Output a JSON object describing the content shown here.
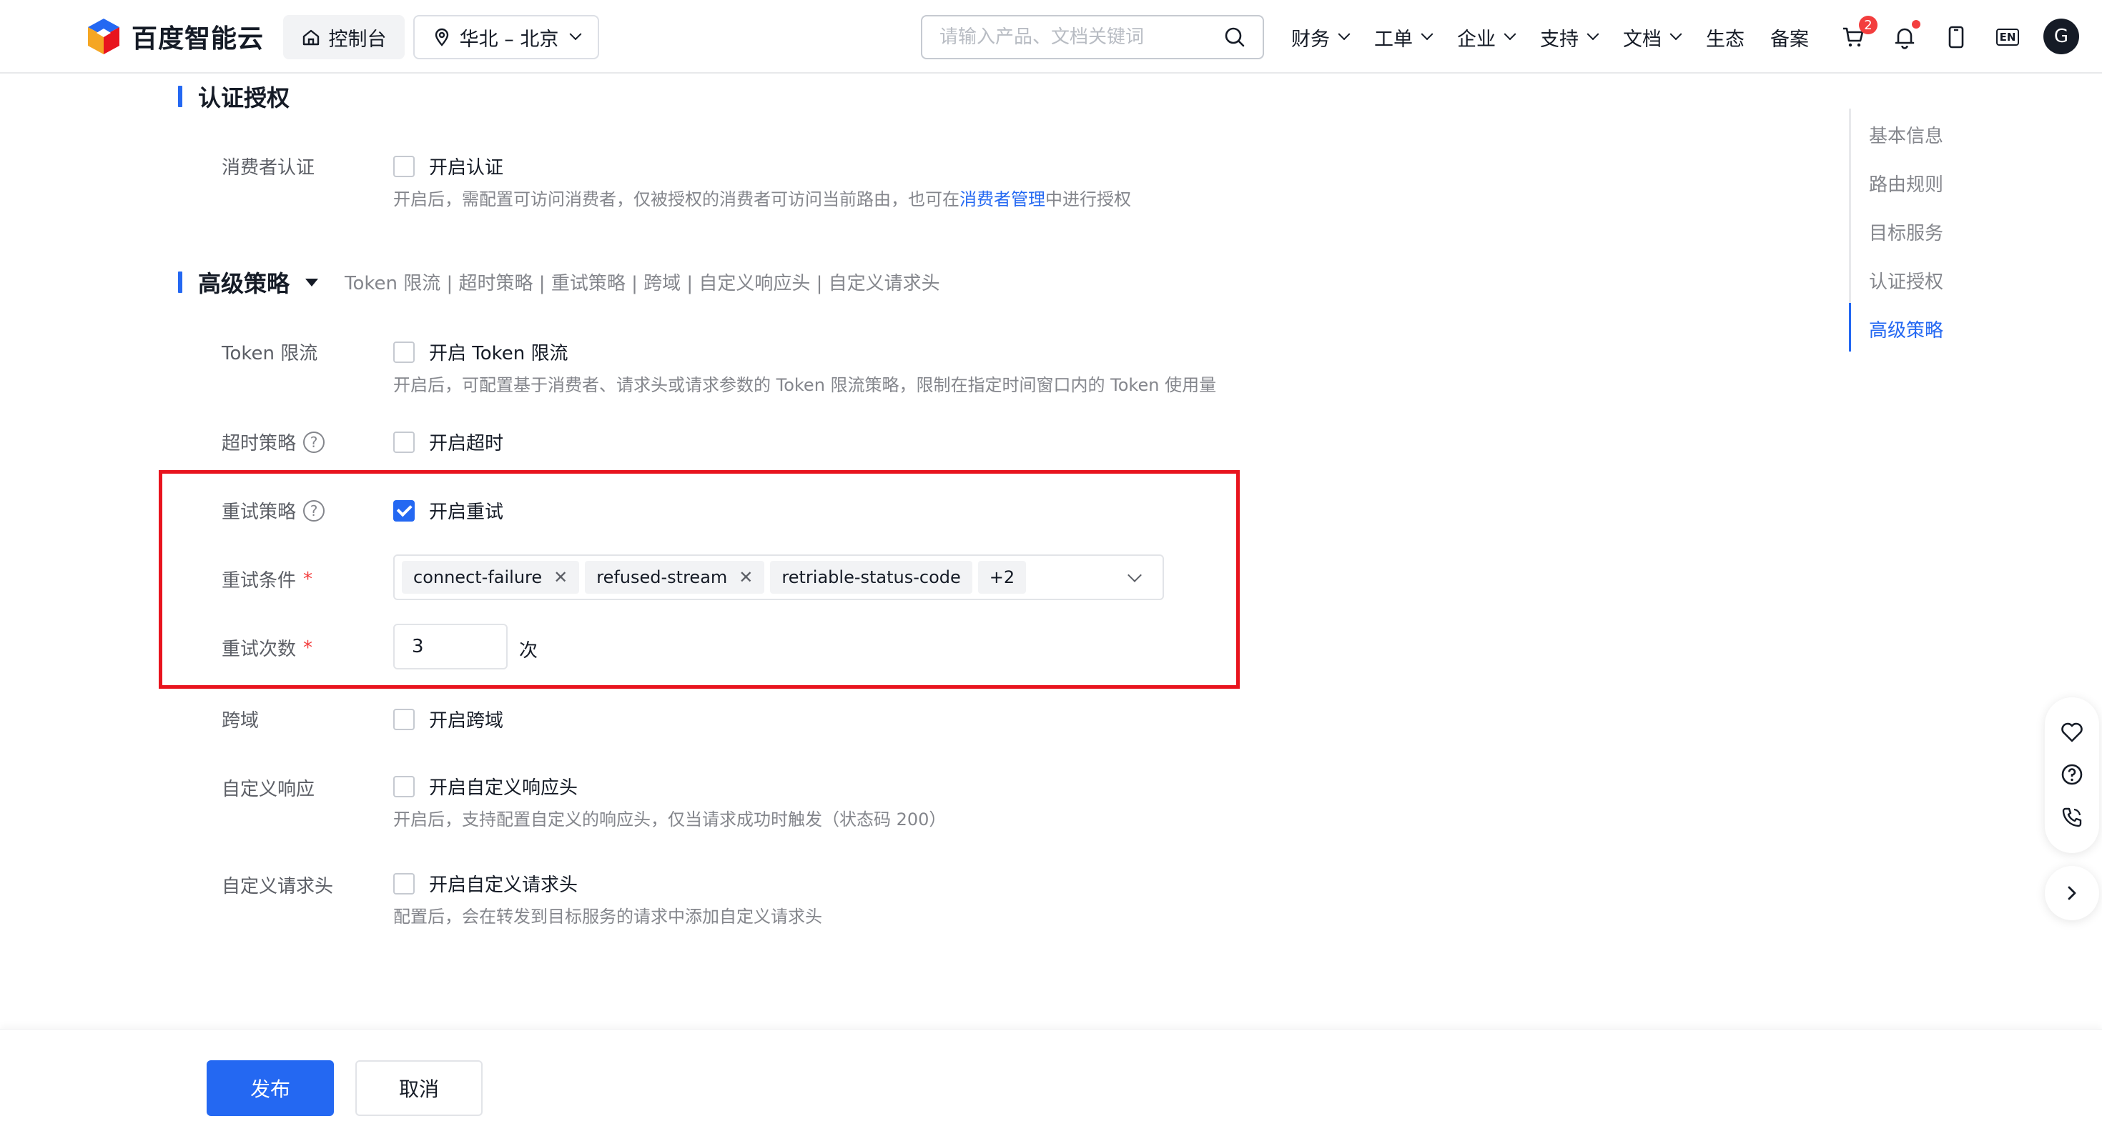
{
  "header": {
    "brand": "百度智能云",
    "console_label": "控制台",
    "region_label": "华北 – 北京",
    "search_placeholder": "请输入产品、文档关键词",
    "menus": [
      {
        "label": "财务",
        "dropdown": true
      },
      {
        "label": "工单",
        "dropdown": true
      },
      {
        "label": "企业",
        "dropdown": true
      },
      {
        "label": "支持",
        "dropdown": true
      },
      {
        "label": "文档",
        "dropdown": true
      },
      {
        "label": "生态",
        "dropdown": false
      },
      {
        "label": "备案",
        "dropdown": false
      }
    ],
    "cart_badge": "2",
    "lang_label": "EN",
    "avatar_initial": "G"
  },
  "auth": {
    "title": "认证授权",
    "consumer": {
      "label": "消费者认证",
      "checkbox_label": "开启认证",
      "checked": false,
      "desc_prefix": "开启后，需配置可访问消费者，仅被授权的消费者可访问当前路由，也可在",
      "desc_link": "消费者管理",
      "desc_suffix": "中进行授权"
    }
  },
  "advanced": {
    "title": "高级策略",
    "tags_summary": "Token 限流 | 超时策略 | 重试策略 | 跨域 | 自定义响应头 | 自定义请求头",
    "token_limit": {
      "label": "Token 限流",
      "checkbox_label": "开启 Token 限流",
      "checked": false,
      "desc": "开启后，可配置基于消费者、请求头或请求参数的 Token 限流策略，限制在指定时间窗口内的 Token 使用量"
    },
    "timeout": {
      "label": "超时策略",
      "checkbox_label": "开启超时",
      "checked": false
    },
    "retry": {
      "label": "重试策略",
      "checkbox_label": "开启重试",
      "checked": true,
      "conditions_label": "重试条件",
      "conditions_tags": [
        "connect-failure",
        "refused-stream",
        "retriable-status-code"
      ],
      "conditions_more": "+2",
      "count_label": "重试次数",
      "count_value": "3",
      "count_unit": "次"
    },
    "cors": {
      "label": "跨域",
      "checkbox_label": "开启跨域",
      "checked": false
    },
    "custom_response": {
      "label": "自定义响应",
      "checkbox_label": "开启自定义响应头",
      "checked": false,
      "desc": "开启后，支持配置自定义的响应头，仅当请求成功时触发（状态码 200）"
    },
    "custom_request": {
      "label": "自定义请求头",
      "checkbox_label": "开启自定义请求头",
      "checked": false,
      "desc": "配置后，会在转发到目标服务的请求中添加自定义请求头"
    }
  },
  "anchor_nav": {
    "items": [
      "基本信息",
      "路由规则",
      "目标服务",
      "认证授权",
      "高级策略"
    ],
    "active_index": 4
  },
  "footer": {
    "publish_label": "发布",
    "cancel_label": "取消"
  },
  "colors": {
    "primary": "#2468f2",
    "highlight_border": "#e8141e",
    "badge": "#f33e3e"
  }
}
